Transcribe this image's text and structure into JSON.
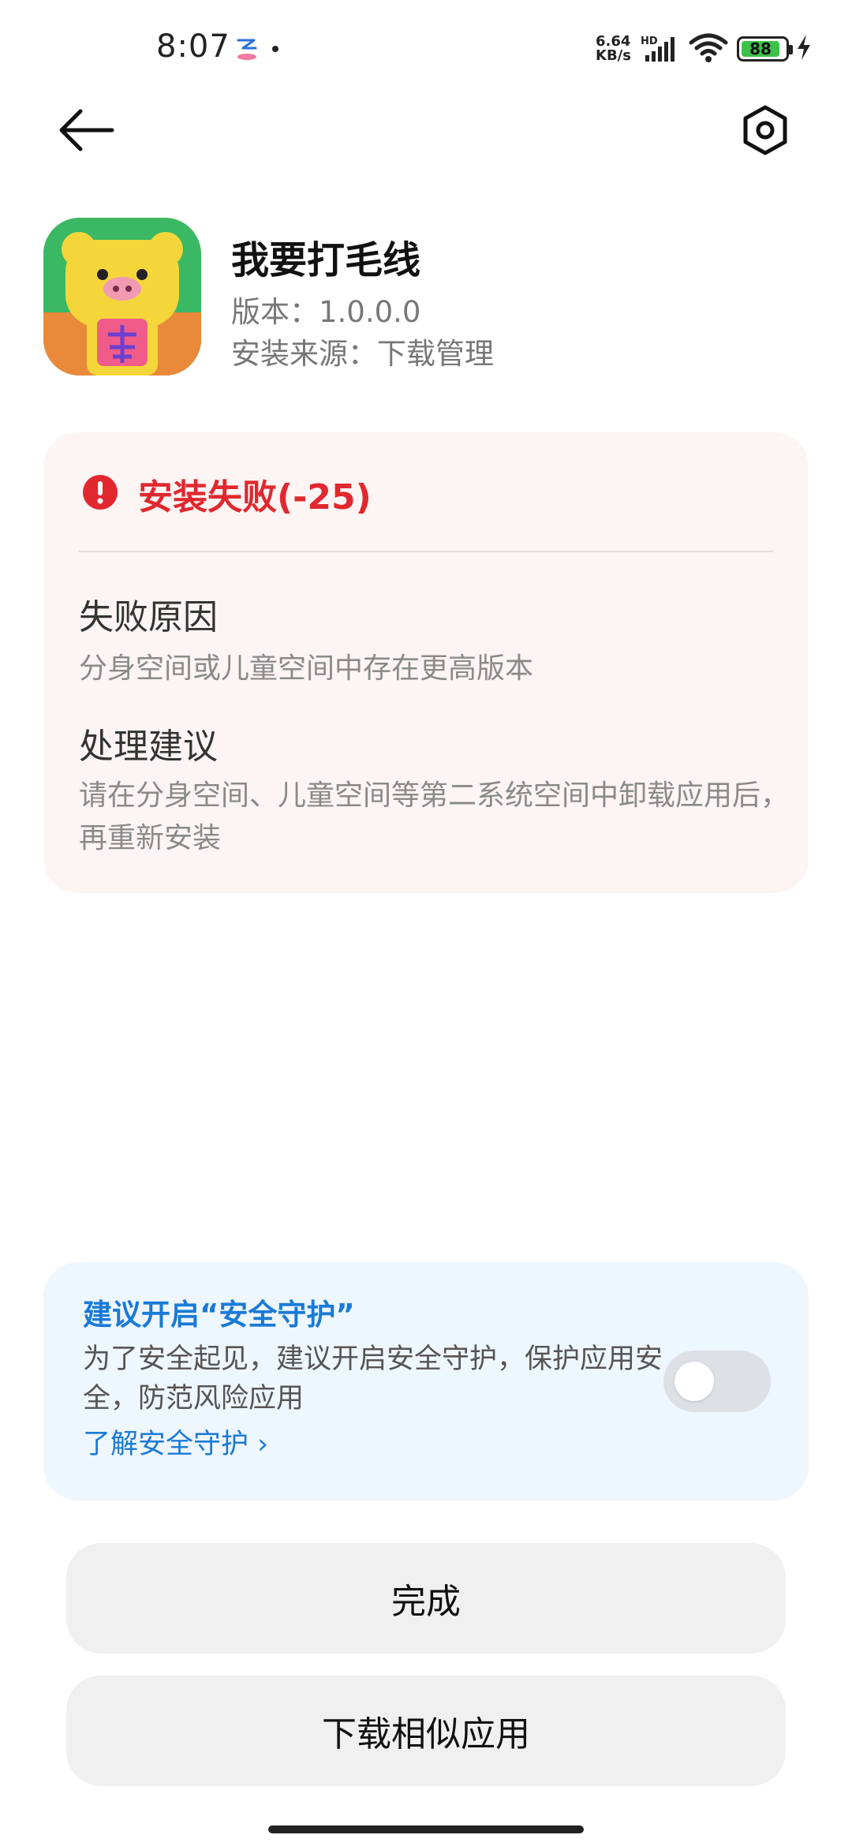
{
  "status_bar": {
    "time": "8:07",
    "net_speed_value": "6.64",
    "net_speed_unit": "KB/s",
    "hd_label": "HD",
    "battery_level": "88"
  },
  "header": {
    "back_icon": "arrow-left-icon",
    "settings_icon": "hexagon-settings-icon"
  },
  "app": {
    "name": "我要打毛线",
    "version": "版本：1.0.0.0",
    "source": "安装来源：下载管理"
  },
  "error": {
    "title": "安装失败(-25)",
    "reason_heading": "失败原因",
    "reason_text": "分身空间或儿童空间中存在更高版本",
    "advice_heading": "处理建议",
    "advice_text": "请在分身空间、儿童空间等第二系统空间中卸载应用后，再重新安装"
  },
  "guard": {
    "title": "建议开启“安全守护”",
    "description": "为了安全起见，建议开启安全守护，保护应用安全，防范风险应用",
    "link": "了解安全守护",
    "toggle_on": false
  },
  "actions": {
    "done": "完成",
    "similar": "下载相似应用"
  },
  "colors": {
    "error_red": "#e0282e",
    "link_blue": "#1a7ad6",
    "error_card_bg": "#fdf4f4",
    "guard_card_bg": "#eef6fe"
  }
}
